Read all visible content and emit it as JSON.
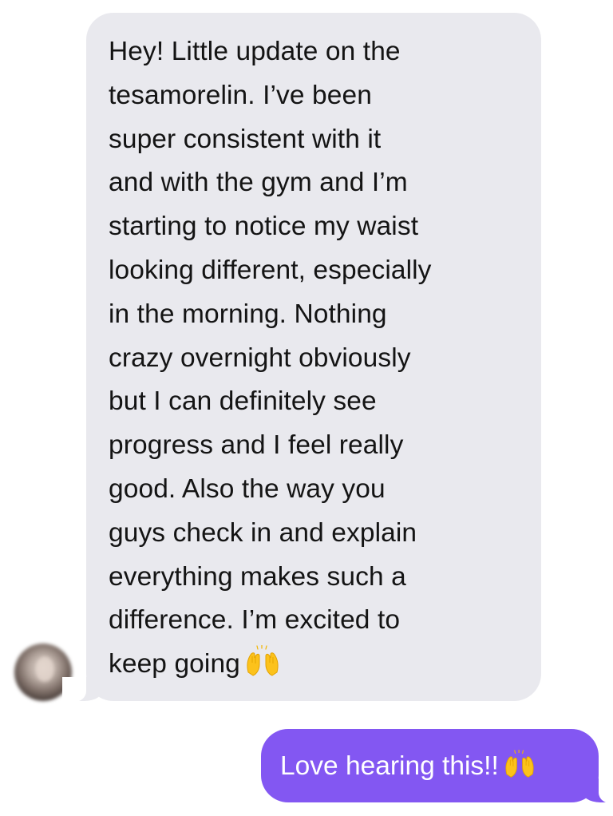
{
  "conversation": {
    "incoming_message": {
      "lines": [
        "Hey! Little update on the",
        "tesamorelin. I’ve been",
        "super consistent with it",
        "and with the gym and I’m",
        "starting to notice my waist",
        "looking different, especially",
        "in the morning. Nothing",
        "crazy overnight obviously",
        "but I can definitely see",
        "progress and I feel really",
        "good. Also the way you",
        "guys check in and explain",
        "everything makes such a",
        "difference. I’m excited to",
        "keep going"
      ],
      "emoji": "raising-hands-emoji",
      "bubble_color": "#e9e9ee",
      "text_color": "#141414"
    },
    "outgoing_message": {
      "text": "Love hearing this!!",
      "emoji": "raising-hands-emoji",
      "bubble_color": "#8357f2",
      "text_color": "#ffffff"
    },
    "sender_avatar": {
      "icon": "contact-avatar"
    }
  }
}
